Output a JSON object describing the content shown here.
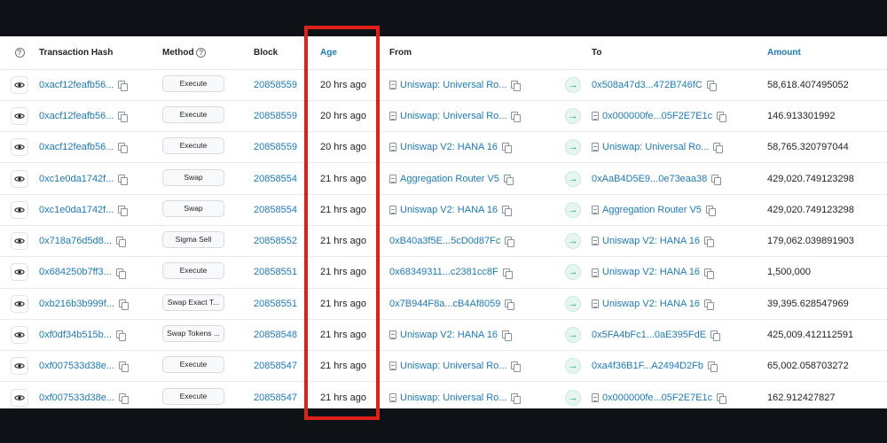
{
  "columns": {
    "transaction_hash": "Transaction Hash",
    "method": "Method",
    "block": "Block",
    "age": "Age",
    "from": "From",
    "to": "To",
    "amount": "Amount"
  },
  "colors": {
    "link": "#1e7ab6",
    "highlight": "#e0201a",
    "arrow": "#00a186"
  },
  "rows": [
    {
      "hash": "0xacf12feafb56...",
      "method": "Execute",
      "block": "20858559",
      "age": "20 hrs ago",
      "from": "Uniswap: Universal Ro...",
      "from_contract": true,
      "to": "0x508a47d3...472B746fC",
      "to_contract": false,
      "amount": "58,618.407495052"
    },
    {
      "hash": "0xacf12feafb56...",
      "method": "Execute",
      "block": "20858559",
      "age": "20 hrs ago",
      "from": "Uniswap: Universal Ro...",
      "from_contract": true,
      "to": "0x000000fe...05F2E7E1c",
      "to_contract": true,
      "amount": "146.913301992"
    },
    {
      "hash": "0xacf12feafb56...",
      "method": "Execute",
      "block": "20858559",
      "age": "20 hrs ago",
      "from": "Uniswap V2: HANA 16",
      "from_contract": true,
      "to": "Uniswap: Universal Ro...",
      "to_contract": true,
      "amount": "58,765.320797044"
    },
    {
      "hash": "0xc1e0da1742f...",
      "method": "Swap",
      "block": "20858554",
      "age": "21 hrs ago",
      "from": "Aggregation Router V5",
      "from_contract": true,
      "to": "0xAaB4D5E9...0e73eaa38",
      "to_contract": false,
      "amount": "429,020.749123298"
    },
    {
      "hash": "0xc1e0da1742f...",
      "method": "Swap",
      "block": "20858554",
      "age": "21 hrs ago",
      "from": "Uniswap V2: HANA 16",
      "from_contract": true,
      "to": "Aggregation Router V5",
      "to_contract": true,
      "amount": "429,020.749123298"
    },
    {
      "hash": "0x718a76d5d8...",
      "method": "Sigma Sell",
      "block": "20858552",
      "age": "21 hrs ago",
      "from": "0xB40a3f5E...5cD0d87Fc",
      "from_contract": false,
      "to": "Uniswap V2: HANA 16",
      "to_contract": true,
      "amount": "179,062.039891903"
    },
    {
      "hash": "0x684250b7ff3...",
      "method": "Execute",
      "block": "20858551",
      "age": "21 hrs ago",
      "from": "0x68349311...c2381cc8F",
      "from_contract": false,
      "to": "Uniswap V2: HANA 16",
      "to_contract": true,
      "amount": "1,500,000"
    },
    {
      "hash": "0xb216b3b999f...",
      "method": "Swap Exact T...",
      "block": "20858551",
      "age": "21 hrs ago",
      "from": "0x7B944F8a...cB4Af8059",
      "from_contract": false,
      "to": "Uniswap V2: HANA 16",
      "to_contract": true,
      "amount": "39,395.628547969"
    },
    {
      "hash": "0xf0df34b515b...",
      "method": "Swap Tokens ...",
      "block": "20858548",
      "age": "21 hrs ago",
      "from": "Uniswap V2: HANA 16",
      "from_contract": true,
      "to": "0x5FA4bFc1...0aE395FdE",
      "to_contract": false,
      "amount": "425,009.412112591"
    },
    {
      "hash": "0xf007533d38e...",
      "method": "Execute",
      "block": "20858547",
      "age": "21 hrs ago",
      "from": "Uniswap: Universal Ro...",
      "from_contract": true,
      "to": "0xa4f36B1F...A2494D2Fb",
      "to_contract": false,
      "amount": "65,002.058703272"
    },
    {
      "hash": "0xf007533d38e...",
      "method": "Execute",
      "block": "20858547",
      "age": "21 hrs ago",
      "from": "Uniswap: Universal Ro...",
      "from_contract": true,
      "to": "0x000000fe...05F2E7E1c",
      "to_contract": true,
      "amount": "162.912427827"
    }
  ]
}
